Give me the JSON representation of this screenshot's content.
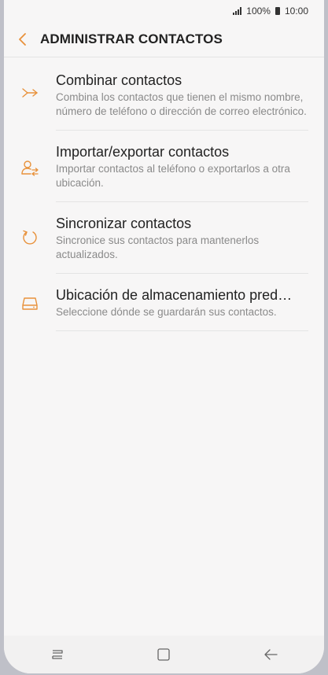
{
  "status_bar": {
    "battery": "100%",
    "time": "10:00"
  },
  "header": {
    "title": "ADMINISTRAR CONTACTOS",
    "back_icon": "chevron-left-icon"
  },
  "items": [
    {
      "icon": "merge-icon",
      "title": "Combinar contactos",
      "description": "Combina los contactos que tienen el mismo nombre, número de teléfono o dirección de correo electrónico."
    },
    {
      "icon": "import-export-icon",
      "title": "Importar/exportar contactos",
      "description": "Importar contactos al teléfono o exportarlos a otra ubicación."
    },
    {
      "icon": "sync-icon",
      "title": "Sincronizar contactos",
      "description": "Sincronice sus contactos para mantenerlos actualizados."
    },
    {
      "icon": "storage-icon",
      "title": "Ubicación de almacenamiento pred…",
      "description": "Seleccione dónde se guardarán sus contactos."
    }
  ],
  "nav_bar": {
    "recent_icon": "recent-apps-icon",
    "home_icon": "home-icon",
    "back_icon": "back-arrow-icon"
  },
  "colors": {
    "accent": "#e8913a",
    "background": "#f7f6f6",
    "title_text": "#222222",
    "desc_text": "#8a8a8a"
  }
}
